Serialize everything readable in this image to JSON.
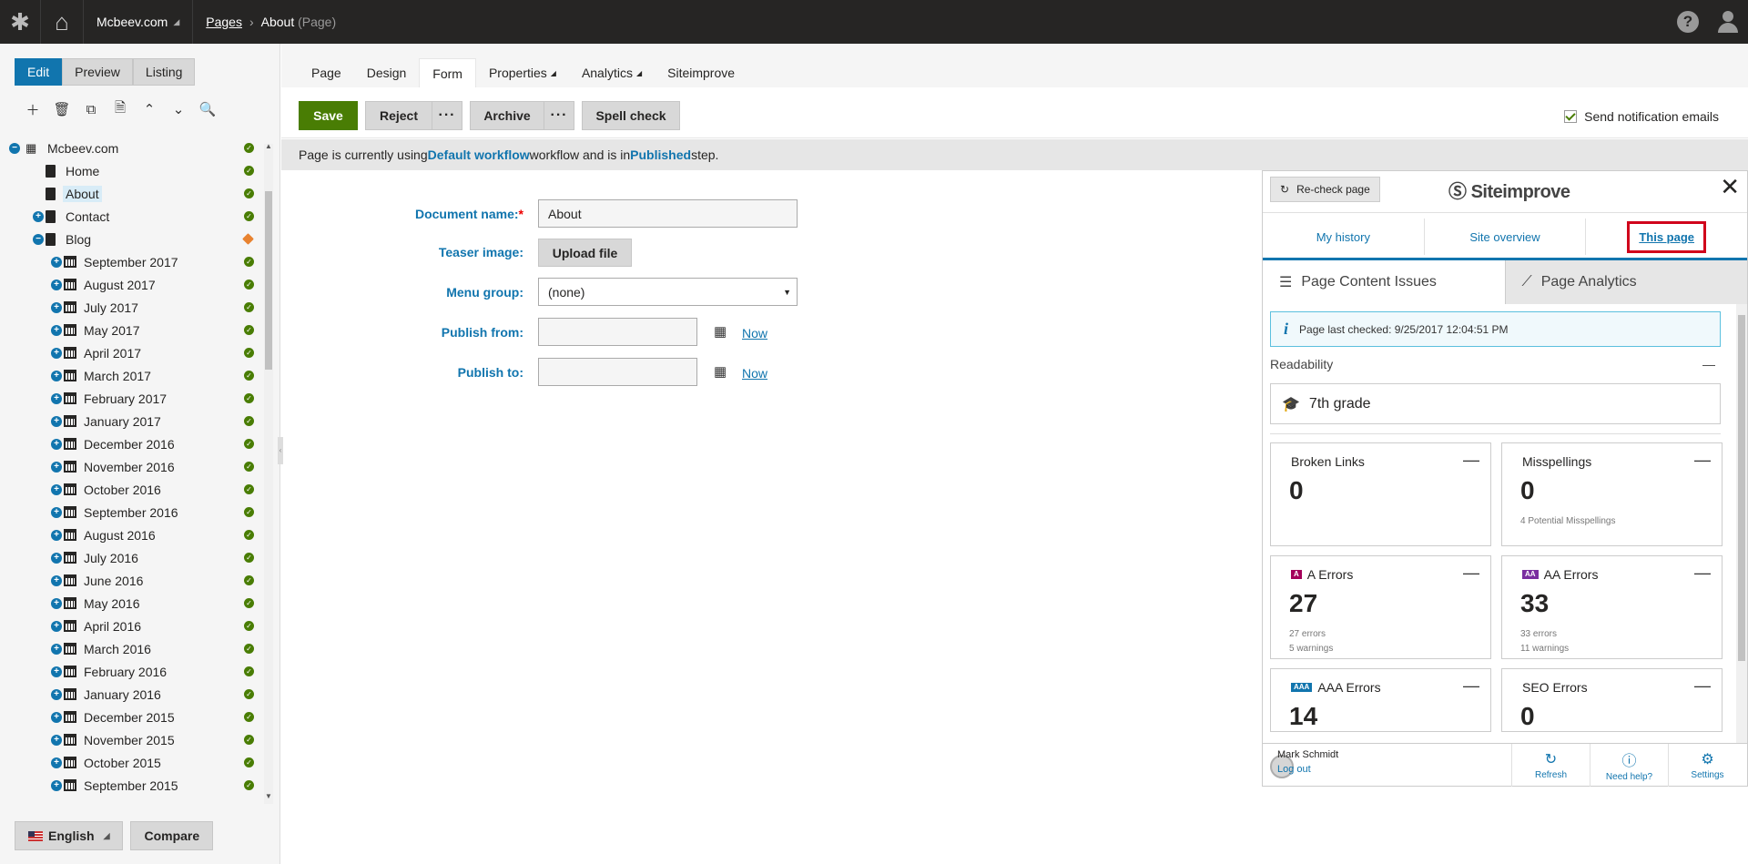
{
  "topbar": {
    "site": "Mcbeev.com",
    "crumb_pages": "Pages",
    "crumb_current": "About",
    "crumb_type": "(Page)"
  },
  "modes": [
    "Edit",
    "Preview",
    "Listing"
  ],
  "tree": {
    "root": "Mcbeev.com",
    "items": [
      {
        "label": "Home",
        "level": 1,
        "type": "doc",
        "exp": "",
        "status": "published"
      },
      {
        "label": "About",
        "level": 1,
        "type": "doc",
        "exp": "",
        "status": "published",
        "selected": true
      },
      {
        "label": "Contact",
        "level": 1,
        "type": "doc",
        "exp": "+",
        "status": "published"
      },
      {
        "label": "Blog",
        "level": 1,
        "type": "doc",
        "exp": "−",
        "status": "edit"
      },
      {
        "label": "September 2017",
        "level": 2,
        "type": "cal",
        "exp": "+",
        "status": "published"
      },
      {
        "label": "August 2017",
        "level": 2,
        "type": "cal",
        "exp": "+",
        "status": "published"
      },
      {
        "label": "July 2017",
        "level": 2,
        "type": "cal",
        "exp": "+",
        "status": "published"
      },
      {
        "label": "May 2017",
        "level": 2,
        "type": "cal",
        "exp": "+",
        "status": "published"
      },
      {
        "label": "April 2017",
        "level": 2,
        "type": "cal",
        "exp": "+",
        "status": "published"
      },
      {
        "label": "March 2017",
        "level": 2,
        "type": "cal",
        "exp": "+",
        "status": "published"
      },
      {
        "label": "February 2017",
        "level": 2,
        "type": "cal",
        "exp": "+",
        "status": "published"
      },
      {
        "label": "January 2017",
        "level": 2,
        "type": "cal",
        "exp": "+",
        "status": "published"
      },
      {
        "label": "December 2016",
        "level": 2,
        "type": "cal",
        "exp": "+",
        "status": "published"
      },
      {
        "label": "November 2016",
        "level": 2,
        "type": "cal",
        "exp": "+",
        "status": "published"
      },
      {
        "label": "October 2016",
        "level": 2,
        "type": "cal",
        "exp": "+",
        "status": "published"
      },
      {
        "label": "September 2016",
        "level": 2,
        "type": "cal",
        "exp": "+",
        "status": "published"
      },
      {
        "label": "August 2016",
        "level": 2,
        "type": "cal",
        "exp": "+",
        "status": "published"
      },
      {
        "label": "July 2016",
        "level": 2,
        "type": "cal",
        "exp": "+",
        "status": "published"
      },
      {
        "label": "June 2016",
        "level": 2,
        "type": "cal",
        "exp": "+",
        "status": "published"
      },
      {
        "label": "May 2016",
        "level": 2,
        "type": "cal",
        "exp": "+",
        "status": "published"
      },
      {
        "label": "April 2016",
        "level": 2,
        "type": "cal",
        "exp": "+",
        "status": "published"
      },
      {
        "label": "March 2016",
        "level": 2,
        "type": "cal",
        "exp": "+",
        "status": "published"
      },
      {
        "label": "February 2016",
        "level": 2,
        "type": "cal",
        "exp": "+",
        "status": "published"
      },
      {
        "label": "January 2016",
        "level": 2,
        "type": "cal",
        "exp": "+",
        "status": "published"
      },
      {
        "label": "December 2015",
        "level": 2,
        "type": "cal",
        "exp": "+",
        "status": "published"
      },
      {
        "label": "November 2015",
        "level": 2,
        "type": "cal",
        "exp": "+",
        "status": "published"
      },
      {
        "label": "October 2015",
        "level": 2,
        "type": "cal",
        "exp": "+",
        "status": "published"
      },
      {
        "label": "September 2015",
        "level": 2,
        "type": "cal",
        "exp": "+",
        "status": "published"
      }
    ]
  },
  "leftbottom": {
    "language": "English",
    "compare": "Compare"
  },
  "tabs": [
    {
      "label": "Page",
      "dropdown": false
    },
    {
      "label": "Design",
      "dropdown": false
    },
    {
      "label": "Form",
      "dropdown": false,
      "active": true
    },
    {
      "label": "Properties",
      "dropdown": true
    },
    {
      "label": "Analytics",
      "dropdown": true
    },
    {
      "label": "Siteimprove",
      "dropdown": false
    }
  ],
  "actions": {
    "save": "Save",
    "reject": "Reject",
    "more": "···",
    "archive": "Archive",
    "spellcheck": "Spell check",
    "notify": "Send notification emails"
  },
  "workflow": {
    "pre": "Page is currently using ",
    "name": "Default workflow",
    "mid": " workflow and is in ",
    "step": "Published",
    "post": " step."
  },
  "form": {
    "docname_label": "Document name:",
    "docname_req": "*",
    "docname_value": "About",
    "teaser_label": "Teaser image:",
    "upload": "Upload file",
    "menu_label": "Menu group:",
    "menu_value": "(none)",
    "from_label": "Publish from:",
    "to_label": "Publish to:",
    "now": "Now"
  },
  "siteimprove": {
    "recheck": "Re-check page",
    "brand": "Siteimprove",
    "nav": [
      "My history",
      "Site overview",
      "This page"
    ],
    "tab_issues": "Page Content Issues",
    "tab_analytics": "Page Analytics",
    "last_checked": "Page last checked: 9/25/2017 12:04:51 PM",
    "readability_label": "Readability",
    "readability_value": "7th grade",
    "cards": [
      {
        "title": "Broken Links",
        "value": "0",
        "sub1": "",
        "sub2": "",
        "badge": ""
      },
      {
        "title": "Misspellings",
        "value": "0",
        "sub1": "4 Potential Misspellings",
        "sub2": "",
        "badge": ""
      },
      {
        "title": "A Errors",
        "value": "27",
        "sub1": "27 errors",
        "sub2": "5 warnings",
        "badge": "A"
      },
      {
        "title": "AA Errors",
        "value": "33",
        "sub1": "33 errors",
        "sub2": "11 warnings",
        "badge": "AA"
      },
      {
        "title": "AAA Errors",
        "value": "14",
        "sub1": "",
        "sub2": "",
        "badge": "AAA"
      },
      {
        "title": "SEO Errors",
        "value": "0",
        "sub1": "",
        "sub2": "",
        "badge": ""
      }
    ],
    "badge_colors": {
      "A": "#a4005a",
      "AA": "#7a2ea0",
      "AAA": "#1175ae"
    },
    "user": "Mark Schmidt",
    "logout": "Log out",
    "footer": [
      "Refresh",
      "Need help?",
      "Settings"
    ]
  }
}
